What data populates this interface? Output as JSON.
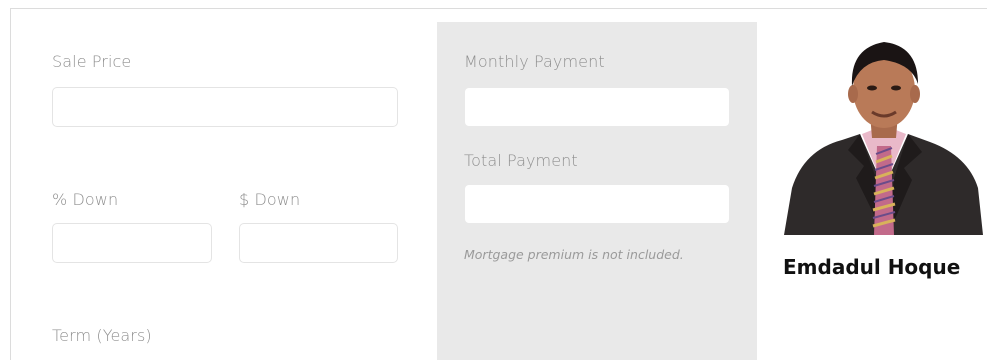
{
  "calculator": {
    "sale_price_label": "Sale Price",
    "percent_down_label": "% Down",
    "dollar_down_label": "$ Down",
    "term_label": "Term (Years)",
    "sale_price_value": "",
    "percent_down_value": "",
    "dollar_down_value": ""
  },
  "results": {
    "monthly_payment_label": "Monthly Payment",
    "total_payment_label": "Total Payment",
    "monthly_payment_value": "",
    "total_payment_value": "",
    "note": "Mortgage premium is not included."
  },
  "agent": {
    "name": "Emdadul Hoque"
  },
  "colors": {
    "panel_background": "#e9e9e9",
    "label_text": "#8f8f8f",
    "name_text": "#111111"
  }
}
